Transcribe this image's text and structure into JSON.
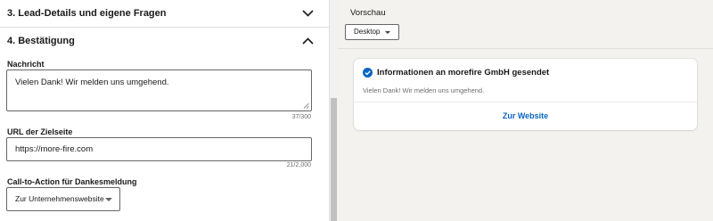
{
  "form": {
    "section3": {
      "title": "3.  Lead-Details und eigene Fragen",
      "chevron": "chevron-down-icon"
    },
    "section4": {
      "title": "4.  Bestätigung",
      "chevron": "chevron-up-icon"
    },
    "message": {
      "label": "Nachricht",
      "value": "Vielen Dank! Wir melden uns umgehend.",
      "counter": "37/300"
    },
    "url": {
      "label": "URL der Zielseite",
      "value": "https://more-fire.com",
      "counter": "21/2,000"
    },
    "cta": {
      "label": "Call-to-Action für Dankesmeldung",
      "value": "Zur Unternehmenswebsite"
    }
  },
  "preview": {
    "title": "Vorschau",
    "device": "Desktop",
    "card": {
      "icon": "check-circle-icon",
      "title": "Informationen an morefire GmbH gesendet",
      "message": "Vielen Dank! Wir melden uns umgehend.",
      "link": "Zur Website"
    }
  },
  "colors": {
    "accent": "#0a66c2",
    "background": "#f3f2ef",
    "panel": "#ffffff"
  }
}
